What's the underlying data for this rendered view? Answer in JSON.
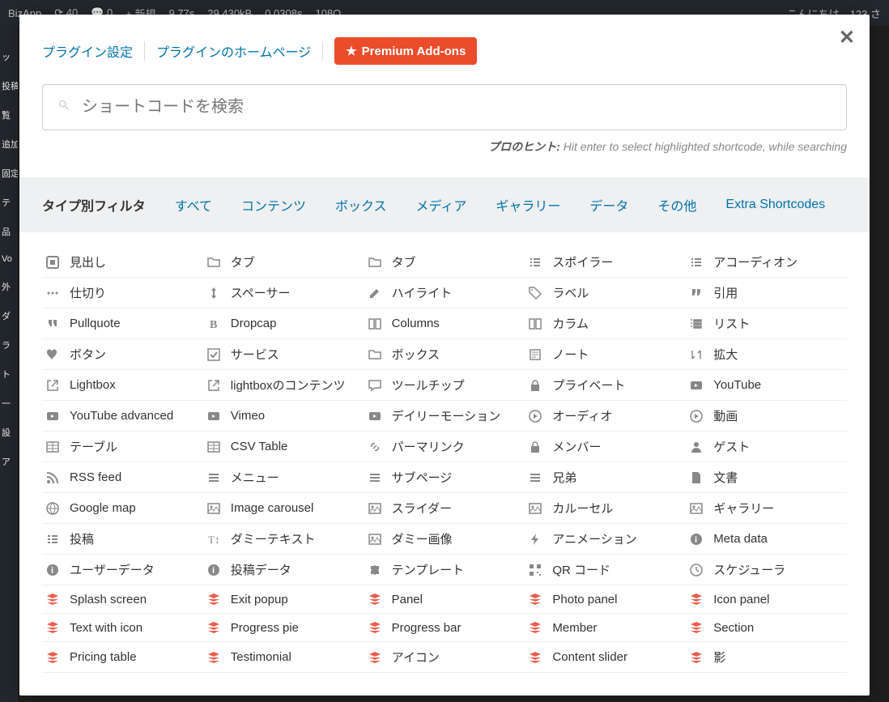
{
  "admin_bar": {
    "site": "BizApp",
    "updates": "40",
    "comments": "0",
    "new": "新規",
    "perf1": "9.77s",
    "perf2": "29,430kB",
    "perf3": "0.0308s",
    "perf4": "108Q",
    "greeting": "こんにちは、123 さ"
  },
  "header": {
    "link_settings": "プラグイン設定",
    "link_homepage": "プラグインのホームページ",
    "premium_btn": "Premium Add-ons"
  },
  "search": {
    "placeholder": "ショートコードを検索"
  },
  "hint": {
    "label": "プロのヒント:",
    "text": " Hit enter to select highlighted shortcode, while searching"
  },
  "filter": {
    "label": "タイプ別フィルタ",
    "items": [
      "すべて",
      "コンテンツ",
      "ボックス",
      "メディア",
      "ギャラリー",
      "データ",
      "その他",
      "Extra Shortcodes"
    ]
  },
  "shortcodes": [
    {
      "l": "見出し",
      "i": "heading"
    },
    {
      "l": "タブ",
      "i": "folder"
    },
    {
      "l": "タブ",
      "i": "folder"
    },
    {
      "l": "スポイラー",
      "i": "list"
    },
    {
      "l": "アコーディオン",
      "i": "list"
    },
    {
      "l": "仕切り",
      "i": "dots"
    },
    {
      "l": "スペーサー",
      "i": "arrows-v"
    },
    {
      "l": "ハイライト",
      "i": "pencil"
    },
    {
      "l": "ラベル",
      "i": "tag"
    },
    {
      "l": "引用",
      "i": "quote"
    },
    {
      "l": "Pullquote",
      "i": "quote-l"
    },
    {
      "l": "Dropcap",
      "i": "bold"
    },
    {
      "l": "Columns",
      "i": "columns"
    },
    {
      "l": "カラム",
      "i": "columns"
    },
    {
      "l": "リスト",
      "i": "list-ol"
    },
    {
      "l": "ボタン",
      "i": "heart"
    },
    {
      "l": "サービス",
      "i": "check-sq"
    },
    {
      "l": "ボックス",
      "i": "folder"
    },
    {
      "l": "ノート",
      "i": "note"
    },
    {
      "l": "拡大",
      "i": "sort"
    },
    {
      "l": "Lightbox",
      "i": "external"
    },
    {
      "l": "lightboxのコンテンツ",
      "i": "external"
    },
    {
      "l": "ツールチップ",
      "i": "comment"
    },
    {
      "l": "プライベート",
      "i": "lock"
    },
    {
      "l": "YouTube",
      "i": "youtube"
    },
    {
      "l": "YouTube advanced",
      "i": "youtube"
    },
    {
      "l": "Vimeo",
      "i": "youtube"
    },
    {
      "l": "デイリーモーション",
      "i": "youtube"
    },
    {
      "l": "オーディオ",
      "i": "play"
    },
    {
      "l": "動画",
      "i": "play"
    },
    {
      "l": "テーブル",
      "i": "table"
    },
    {
      "l": "CSV Table",
      "i": "table"
    },
    {
      "l": "パーマリンク",
      "i": "link"
    },
    {
      "l": "メンバー",
      "i": "lock"
    },
    {
      "l": "ゲスト",
      "i": "user"
    },
    {
      "l": "RSS feed",
      "i": "rss"
    },
    {
      "l": "メニュー",
      "i": "bars"
    },
    {
      "l": "サブページ",
      "i": "bars"
    },
    {
      "l": "兄弟",
      "i": "bars"
    },
    {
      "l": "文書",
      "i": "file"
    },
    {
      "l": "Google map",
      "i": "globe"
    },
    {
      "l": "Image carousel",
      "i": "image"
    },
    {
      "l": "スライダー",
      "i": "image"
    },
    {
      "l": "カルーセル",
      "i": "image"
    },
    {
      "l": "ギャラリー",
      "i": "image"
    },
    {
      "l": "投稿",
      "i": "list-alt"
    },
    {
      "l": "ダミーテキスト",
      "i": "text-h"
    },
    {
      "l": "ダミー画像",
      "i": "image"
    },
    {
      "l": "アニメーション",
      "i": "bolt"
    },
    {
      "l": "Meta data",
      "i": "info"
    },
    {
      "l": "ユーザーデータ",
      "i": "info"
    },
    {
      "l": "投稿データ",
      "i": "info"
    },
    {
      "l": "テンプレート",
      "i": "puzzle"
    },
    {
      "l": "QR コード",
      "i": "qr"
    },
    {
      "l": "スケジューラ",
      "i": "clock"
    },
    {
      "l": "Splash screen",
      "i": "stack",
      "p": true
    },
    {
      "l": "Exit popup",
      "i": "stack",
      "p": true
    },
    {
      "l": "Panel",
      "i": "stack",
      "p": true
    },
    {
      "l": "Photo panel",
      "i": "stack",
      "p": true
    },
    {
      "l": "Icon panel",
      "i": "stack",
      "p": true
    },
    {
      "l": "Text with icon",
      "i": "stack",
      "p": true
    },
    {
      "l": "Progress pie",
      "i": "stack",
      "p": true
    },
    {
      "l": "Progress bar",
      "i": "stack",
      "p": true
    },
    {
      "l": "Member",
      "i": "stack",
      "p": true
    },
    {
      "l": "Section",
      "i": "stack",
      "p": true
    },
    {
      "l": "Pricing table",
      "i": "stack",
      "p": true
    },
    {
      "l": "Testimonial",
      "i": "stack",
      "p": true
    },
    {
      "l": "アイコン",
      "i": "stack",
      "p": true
    },
    {
      "l": "Content slider",
      "i": "stack",
      "p": true
    },
    {
      "l": "影",
      "i": "stack",
      "p": true
    }
  ]
}
